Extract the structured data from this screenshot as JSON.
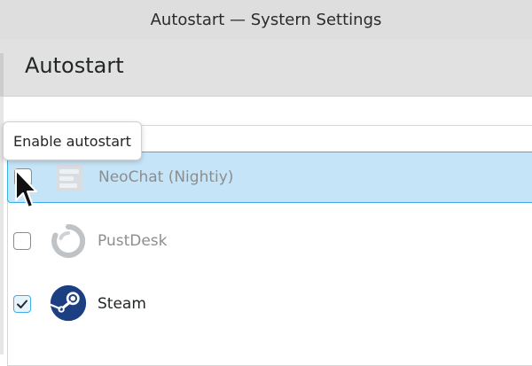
{
  "window": {
    "title": "Autostart — Systern Settings"
  },
  "page": {
    "title": "Autostart"
  },
  "tooltip": {
    "text": "Enable autostart"
  },
  "entries": [
    {
      "name": "NeoChat (Nightiy)",
      "checked": false,
      "selected": true,
      "dimmed": true,
      "icon": "neochat-icon"
    },
    {
      "name": "PustDesk",
      "checked": false,
      "selected": false,
      "dimmed": true,
      "icon": "rustdesk-icon"
    },
    {
      "name": "Steam",
      "checked": true,
      "selected": false,
      "dimmed": false,
      "icon": "steam-icon"
    }
  ],
  "colors": {
    "selection_bg": "#c6e4f8",
    "selection_border": "#3daee9",
    "steam_blue": "#1b3f80",
    "check_color": "#1f2a33"
  }
}
